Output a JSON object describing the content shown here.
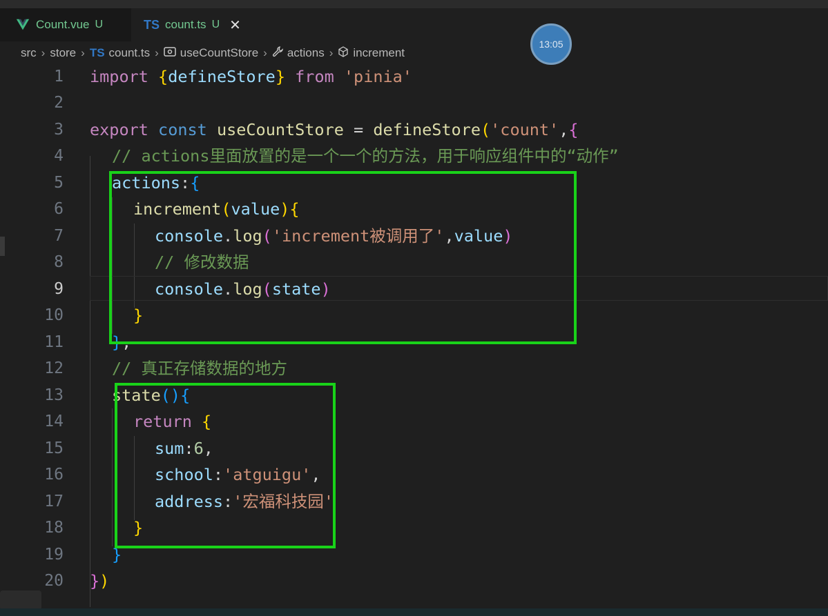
{
  "tabs": [
    {
      "icon": "vue-icon",
      "name": "Count.vue",
      "status": "U"
    },
    {
      "icon": "ts-icon",
      "badge": "TS",
      "name": "count.ts",
      "status": "U",
      "close": "✕"
    }
  ],
  "breadcrumb": {
    "items": [
      "src",
      "store",
      "count.ts",
      "useCountStore",
      "actions",
      "increment"
    ],
    "ts_badge": "TS",
    "separator": "›"
  },
  "clock": "13:05",
  "editor": {
    "line_numbers": [
      "1",
      "2",
      "3",
      "4",
      "5",
      "6",
      "7",
      "8",
      "9",
      "10",
      "11",
      "12",
      "13",
      "14",
      "15",
      "16",
      "17",
      "18",
      "19",
      "20"
    ],
    "current_line": "9",
    "code": {
      "l1": {
        "import": "import",
        "ob": "{",
        "name": "defineStore",
        "cb": "}",
        "from": "from",
        "str": "'pinia'"
      },
      "l3": {
        "export": "export",
        "const": "const",
        "name": "useCountStore",
        "eq": "=",
        "fn": "defineStore",
        "op": "(",
        "str": "'count'",
        "comma": ",",
        "ob": "{"
      },
      "l4": "// actions里面放置的是一个一个的方法，用于响应组件中的“动作”",
      "l5": {
        "key": "actions",
        "colon": ":",
        "ob": "{"
      },
      "l6": {
        "fn": "increment",
        "op": "(",
        "param": "value",
        "cp": ")",
        "ob": "{"
      },
      "l7": {
        "obj": "console",
        "dot": ".",
        "fn": "log",
        "op": "(",
        "str": "'increment被调用了'",
        "comma": ",",
        "arg": "value",
        "cp": ")"
      },
      "l8": "// 修改数据",
      "l9": {
        "obj": "console",
        "dot": ".",
        "fn": "log",
        "op": "(",
        "arg": "state",
        "cp": ")"
      },
      "l10": "}",
      "l11": {
        "cb": "}",
        "comma": ","
      },
      "l12": "// 真正存储数据的地方",
      "l13": {
        "fn": "state",
        "op": "(",
        "cp": ")",
        "ob": "{"
      },
      "l14": {
        "kw": "return",
        "ob": "{"
      },
      "l15": {
        "key": "sum",
        "colon": ":",
        "num": "6",
        "comma": ","
      },
      "l16": {
        "key": "school",
        "colon": ":",
        "str": "'atguigu'",
        "comma": ","
      },
      "l17": {
        "key": "address",
        "colon": ":",
        "str": "'宏福科技园'"
      },
      "l18": "}",
      "l19": "}",
      "l20": {
        "cb": "}",
        "cp": ")"
      }
    }
  },
  "colors": {
    "highlight_box": "#19d219",
    "keyword": "#c586c0",
    "storage": "#569cd6",
    "function": "#dcdcaa",
    "variable": "#9cdcfe",
    "string": "#ce9178",
    "comment": "#6a9955"
  }
}
